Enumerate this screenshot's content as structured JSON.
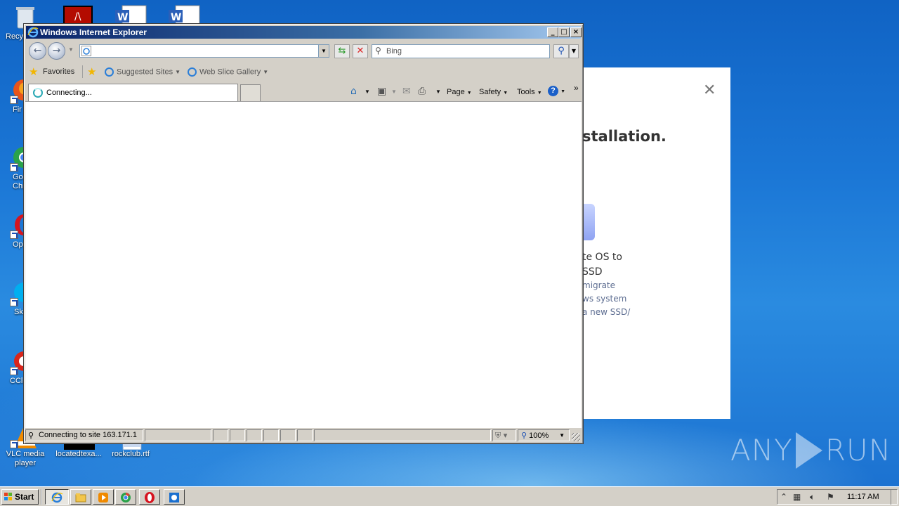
{
  "desktop": {
    "icons": [
      {
        "label": "Recy"
      },
      {
        "label": "Fir"
      },
      {
        "label": "Go\nChr"
      },
      {
        "label": "Op"
      },
      {
        "label": "Sk"
      },
      {
        "label": "CCle"
      },
      {
        "label": "VLC media player"
      },
      {
        "label": "locatedtexa..."
      },
      {
        "label": "rockclub.rtf"
      }
    ]
  },
  "installer": {
    "headline": "stallation.",
    "line1": "te OS to",
    "line2": "SSD",
    "sub1": "migrate",
    "sub2": "ws system",
    "sub3": "a new SSD/"
  },
  "ie": {
    "title": "Windows Internet Explorer",
    "minimize": "_",
    "maximize": "□",
    "close": "×",
    "address_value": "",
    "search_placeholder": "Bing",
    "favorites": {
      "label": "Favorites",
      "suggested": "Suggested Sites",
      "web_slice": "Web Slice Gallery"
    },
    "tab": {
      "label": "Connecting..."
    },
    "commands": {
      "page": "Page",
      "safety": "Safety",
      "tools": "Tools"
    },
    "status": {
      "text": "Connecting to site 163.171.1",
      "zoom": "100%"
    }
  },
  "taskbar": {
    "start": "Start",
    "clock": "11:17 AM"
  },
  "watermark": {
    "left": "ANY",
    "right": "RUN"
  },
  "colors": {
    "titlebar": "#0a246a",
    "desktop": "#1b77d6"
  }
}
